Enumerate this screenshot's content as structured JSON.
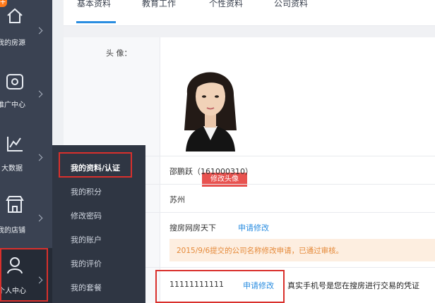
{
  "tabs": [
    "基本资料",
    "教育工作",
    "个性资料",
    "公司资料"
  ],
  "sidebar": {
    "items": [
      {
        "label": "我的房源",
        "icon": "home-icon"
      },
      {
        "label": "推广中心",
        "icon": "promotion-icon"
      },
      {
        "label": "大数据",
        "icon": "chart-icon"
      },
      {
        "label": "我的店铺",
        "icon": "shop-icon"
      },
      {
        "label": "个人中心",
        "icon": "user-icon"
      }
    ],
    "corner_badge": "+"
  },
  "submenu": {
    "items": [
      "我的资料/认证",
      "我的积分",
      "修改密码",
      "我的账户",
      "我的评价",
      "我的套餐"
    ]
  },
  "form": {
    "avatar_label": "头   像：",
    "change_photo": "修改头像",
    "name_value": "邵鹏跃（161000310）",
    "city_value": "苏州",
    "company_value": "搜房网房天下",
    "company_apply": "申请修改",
    "notice": "2015/9/6提交的公司名称修改申请，已通过审核。",
    "phone_value": "11111111111",
    "phone_apply": "申请修改",
    "phone_hint": "真实手机号是您在搜房进行交易的凭证"
  },
  "colors": {
    "accent": "#2a8de0",
    "highlight": "#d9302c",
    "sidebar": "#3a4252"
  }
}
